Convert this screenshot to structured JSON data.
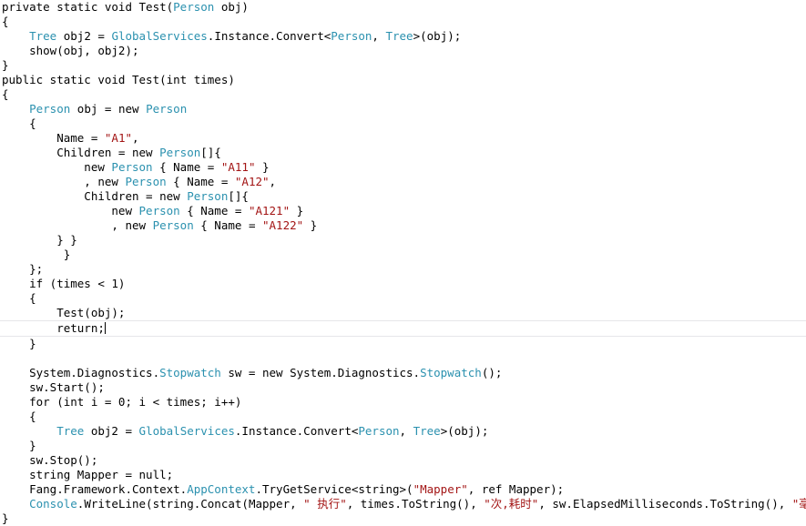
{
  "editor": {
    "background_color": "#ffffff",
    "text_color": "#000000",
    "type_color": "#2b91af",
    "string_color": "#a31515",
    "current_line_border_color": "#e6e6e9",
    "font_size_px": 12.5,
    "line_height_px": 16,
    "language": "csharp",
    "cursor_line_index": 22,
    "cursor_text": "return;"
  },
  "lines": [
    {
      "index": 0,
      "indent": 0,
      "current": false,
      "tokens": [
        {
          "t": "plain",
          "v": "private static void Test("
        },
        {
          "t": "type",
          "v": "Person"
        },
        {
          "t": "plain",
          "v": " obj)"
        }
      ]
    },
    {
      "index": 1,
      "indent": 0,
      "current": false,
      "tokens": [
        {
          "t": "plain",
          "v": "{"
        }
      ]
    },
    {
      "index": 2,
      "indent": 0,
      "current": false,
      "tokens": [
        {
          "t": "plain",
          "v": "    "
        },
        {
          "t": "type",
          "v": "Tree"
        },
        {
          "t": "plain",
          "v": " obj2 = "
        },
        {
          "t": "type",
          "v": "GlobalServices"
        },
        {
          "t": "plain",
          "v": ".Instance.Convert<"
        },
        {
          "t": "type",
          "v": "Person"
        },
        {
          "t": "plain",
          "v": ", "
        },
        {
          "t": "type",
          "v": "Tree"
        },
        {
          "t": "plain",
          "v": ">(obj);"
        }
      ]
    },
    {
      "index": 3,
      "indent": 0,
      "current": false,
      "tokens": [
        {
          "t": "plain",
          "v": "    show(obj, obj2);"
        }
      ]
    },
    {
      "index": 4,
      "indent": 0,
      "current": false,
      "tokens": [
        {
          "t": "plain",
          "v": "}"
        }
      ]
    },
    {
      "index": 5,
      "indent": 0,
      "current": false,
      "tokens": [
        {
          "t": "plain",
          "v": "public static void Test(int times)"
        }
      ]
    },
    {
      "index": 6,
      "indent": 0,
      "current": false,
      "tokens": [
        {
          "t": "plain",
          "v": "{"
        }
      ]
    },
    {
      "index": 7,
      "indent": 0,
      "current": false,
      "tokens": [
        {
          "t": "plain",
          "v": "    "
        },
        {
          "t": "type",
          "v": "Person"
        },
        {
          "t": "plain",
          "v": " obj = new "
        },
        {
          "t": "type",
          "v": "Person"
        }
      ]
    },
    {
      "index": 8,
      "indent": 0,
      "current": false,
      "tokens": [
        {
          "t": "plain",
          "v": "    {"
        }
      ]
    },
    {
      "index": 9,
      "indent": 0,
      "current": false,
      "tokens": [
        {
          "t": "plain",
          "v": "        Name = "
        },
        {
          "t": "str",
          "v": "\"A1\""
        },
        {
          "t": "plain",
          "v": ","
        }
      ]
    },
    {
      "index": 10,
      "indent": 0,
      "current": false,
      "tokens": [
        {
          "t": "plain",
          "v": "        Children = new "
        },
        {
          "t": "type",
          "v": "Person"
        },
        {
          "t": "plain",
          "v": "[]{"
        }
      ]
    },
    {
      "index": 11,
      "indent": 0,
      "current": false,
      "tokens": [
        {
          "t": "plain",
          "v": "            new "
        },
        {
          "t": "type",
          "v": "Person"
        },
        {
          "t": "plain",
          "v": " { Name = "
        },
        {
          "t": "str",
          "v": "\"A11\""
        },
        {
          "t": "plain",
          "v": " }"
        }
      ]
    },
    {
      "index": 12,
      "indent": 0,
      "current": false,
      "tokens": [
        {
          "t": "plain",
          "v": "            , new "
        },
        {
          "t": "type",
          "v": "Person"
        },
        {
          "t": "plain",
          "v": " { Name = "
        },
        {
          "t": "str",
          "v": "\"A12\""
        },
        {
          "t": "plain",
          "v": ","
        }
      ]
    },
    {
      "index": 13,
      "indent": 0,
      "current": false,
      "tokens": [
        {
          "t": "plain",
          "v": "            Children = new "
        },
        {
          "t": "type",
          "v": "Person"
        },
        {
          "t": "plain",
          "v": "[]{"
        }
      ]
    },
    {
      "index": 14,
      "indent": 0,
      "current": false,
      "tokens": [
        {
          "t": "plain",
          "v": "                new "
        },
        {
          "t": "type",
          "v": "Person"
        },
        {
          "t": "plain",
          "v": " { Name = "
        },
        {
          "t": "str",
          "v": "\"A121\""
        },
        {
          "t": "plain",
          "v": " }"
        }
      ]
    },
    {
      "index": 15,
      "indent": 0,
      "current": false,
      "tokens": [
        {
          "t": "plain",
          "v": "                , new "
        },
        {
          "t": "type",
          "v": "Person"
        },
        {
          "t": "plain",
          "v": " { Name = "
        },
        {
          "t": "str",
          "v": "\"A122\""
        },
        {
          "t": "plain",
          "v": " }"
        }
      ]
    },
    {
      "index": 16,
      "indent": 0,
      "current": false,
      "tokens": [
        {
          "t": "plain",
          "v": "        } }"
        }
      ]
    },
    {
      "index": 17,
      "indent": 0,
      "current": false,
      "tokens": [
        {
          "t": "plain",
          "v": "         }"
        }
      ]
    },
    {
      "index": 18,
      "indent": 0,
      "current": false,
      "tokens": [
        {
          "t": "plain",
          "v": "    };"
        }
      ]
    },
    {
      "index": 19,
      "indent": 0,
      "current": false,
      "tokens": [
        {
          "t": "plain",
          "v": "    if (times < 1)"
        }
      ]
    },
    {
      "index": 20,
      "indent": 0,
      "current": false,
      "tokens": [
        {
          "t": "plain",
          "v": "    {"
        }
      ]
    },
    {
      "index": 21,
      "indent": 0,
      "current": false,
      "tokens": [
        {
          "t": "plain",
          "v": "        Test(obj);"
        }
      ]
    },
    {
      "index": 22,
      "indent": 0,
      "current": true,
      "tokens": [
        {
          "t": "plain",
          "v": "        return;"
        },
        {
          "t": "caret",
          "v": ""
        }
      ]
    },
    {
      "index": 23,
      "indent": 0,
      "current": false,
      "tokens": [
        {
          "t": "plain",
          "v": "    }"
        }
      ]
    },
    {
      "index": 24,
      "indent": 0,
      "current": false,
      "tokens": [
        {
          "t": "plain",
          "v": ""
        }
      ]
    },
    {
      "index": 25,
      "indent": 0,
      "current": false,
      "tokens": [
        {
          "t": "plain",
          "v": "    System.Diagnostics."
        },
        {
          "t": "type",
          "v": "Stopwatch"
        },
        {
          "t": "plain",
          "v": " sw = new System.Diagnostics."
        },
        {
          "t": "type",
          "v": "Stopwatch"
        },
        {
          "t": "plain",
          "v": "();"
        }
      ]
    },
    {
      "index": 26,
      "indent": 0,
      "current": false,
      "tokens": [
        {
          "t": "plain",
          "v": "    sw.Start();"
        }
      ]
    },
    {
      "index": 27,
      "indent": 0,
      "current": false,
      "tokens": [
        {
          "t": "plain",
          "v": "    for (int i = 0; i < times; i++)"
        }
      ]
    },
    {
      "index": 28,
      "indent": 0,
      "current": false,
      "tokens": [
        {
          "t": "plain",
          "v": "    {"
        }
      ]
    },
    {
      "index": 29,
      "indent": 0,
      "current": false,
      "tokens": [
        {
          "t": "plain",
          "v": "        "
        },
        {
          "t": "type",
          "v": "Tree"
        },
        {
          "t": "plain",
          "v": " obj2 = "
        },
        {
          "t": "type",
          "v": "GlobalServices"
        },
        {
          "t": "plain",
          "v": ".Instance.Convert<"
        },
        {
          "t": "type",
          "v": "Person"
        },
        {
          "t": "plain",
          "v": ", "
        },
        {
          "t": "type",
          "v": "Tree"
        },
        {
          "t": "plain",
          "v": ">(obj);"
        }
      ]
    },
    {
      "index": 30,
      "indent": 0,
      "current": false,
      "tokens": [
        {
          "t": "plain",
          "v": "    }"
        }
      ]
    },
    {
      "index": 31,
      "indent": 0,
      "current": false,
      "tokens": [
        {
          "t": "plain",
          "v": "    sw.Stop();"
        }
      ]
    },
    {
      "index": 32,
      "indent": 0,
      "current": false,
      "tokens": [
        {
          "t": "plain",
          "v": "    string Mapper = null;"
        }
      ]
    },
    {
      "index": 33,
      "indent": 0,
      "current": false,
      "tokens": [
        {
          "t": "plain",
          "v": "    Fang.Framework.Context."
        },
        {
          "t": "type",
          "v": "AppContext"
        },
        {
          "t": "plain",
          "v": ".TryGetService<string>("
        },
        {
          "t": "str",
          "v": "\"Mapper\""
        },
        {
          "t": "plain",
          "v": ", ref Mapper);"
        }
      ]
    },
    {
      "index": 34,
      "indent": 0,
      "current": false,
      "tokens": [
        {
          "t": "plain",
          "v": "    "
        },
        {
          "t": "type",
          "v": "Console"
        },
        {
          "t": "plain",
          "v": ".WriteLine(string.Concat(Mapper, "
        },
        {
          "t": "str",
          "v": "\" 执行\""
        },
        {
          "t": "plain",
          "v": ", times.ToString(), "
        },
        {
          "t": "str",
          "v": "\"次,耗时\""
        },
        {
          "t": "plain",
          "v": ", sw.ElapsedMilliseconds.ToString(), "
        },
        {
          "t": "str",
          "v": "\"毫秒\""
        },
        {
          "t": "plain",
          "v": "));"
        }
      ]
    },
    {
      "index": 35,
      "indent": 0,
      "current": false,
      "tokens": [
        {
          "t": "plain",
          "v": "}"
        }
      ]
    }
  ]
}
